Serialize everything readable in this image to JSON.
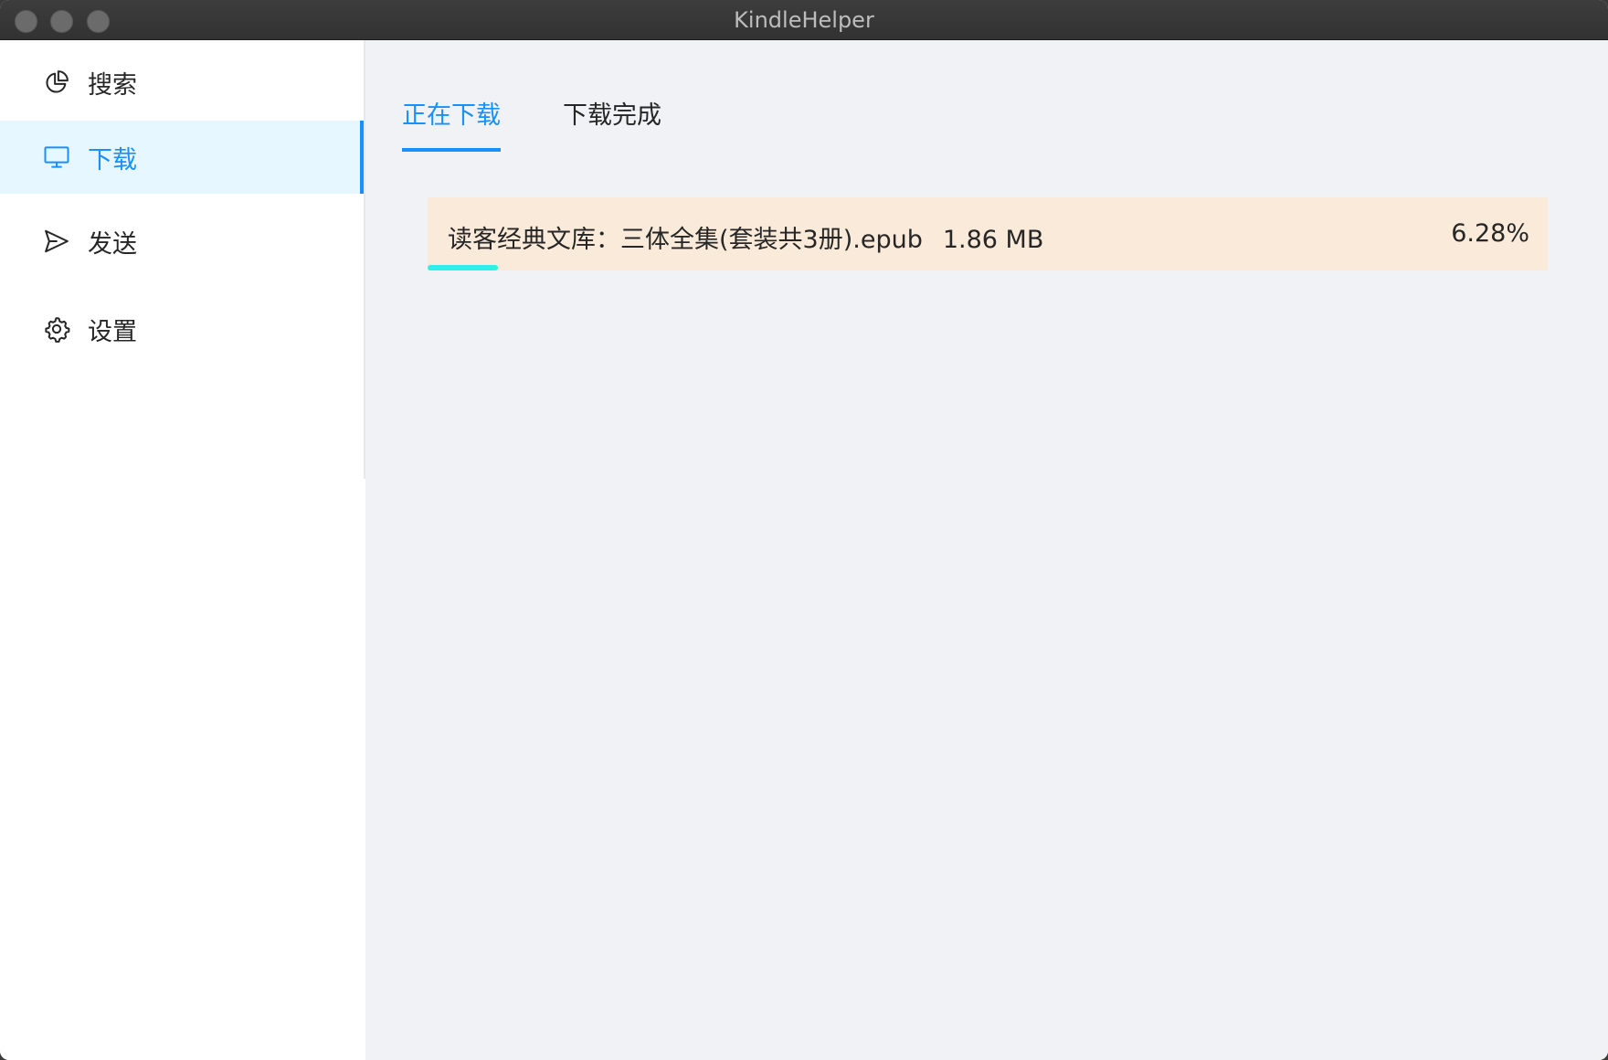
{
  "window": {
    "title": "KindleHelper"
  },
  "sidebar": {
    "items": [
      {
        "label": "搜索",
        "icon": "pie-chart-icon",
        "active": false
      },
      {
        "label": "下载",
        "icon": "desktop-icon",
        "active": true
      },
      {
        "label": "发送",
        "icon": "send-icon",
        "active": false
      },
      {
        "label": "设置",
        "icon": "gear-icon",
        "active": false
      }
    ]
  },
  "main": {
    "tabs": [
      {
        "label": "正在下载",
        "active": true
      },
      {
        "label": "下载完成",
        "active": false
      }
    ],
    "downloads": [
      {
        "name": "读客经典文库：三体全集(套装共3册).epub",
        "size": "1.86 MB",
        "percent": "6.28%",
        "progress": 0.0628
      }
    ]
  },
  "colors": {
    "accent": "#1890ff",
    "progress": "#2df0e8",
    "item_background": "#f9ead9"
  }
}
